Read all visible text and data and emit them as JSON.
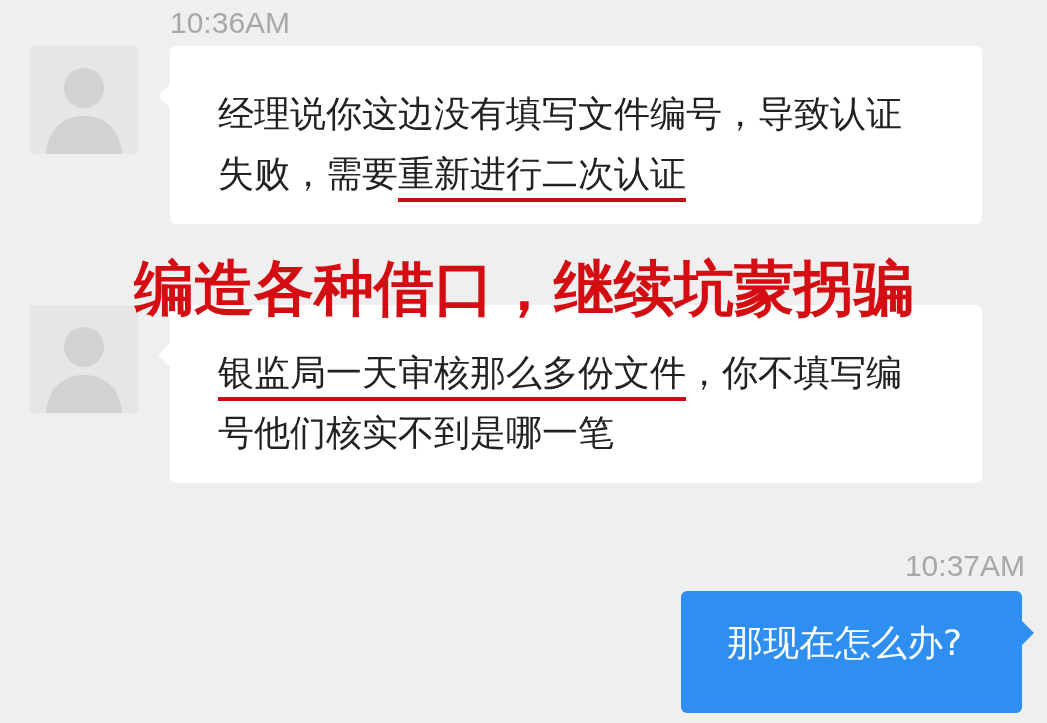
{
  "messages": [
    {
      "time": "10:36AM",
      "kind": "incoming",
      "parts": [
        {
          "text": "经理说你这边没有填写文件编号，导致认证失败，需要",
          "underlined": false
        },
        {
          "text": "重新进行二次认证",
          "underlined": true
        }
      ]
    },
    {
      "kind": "incoming",
      "parts": [
        {
          "text": "银监局一天审核那么多份文件",
          "underlined": true
        },
        {
          "text": "，你不填写编号他们核实不到是哪一笔",
          "underlined": false
        }
      ]
    },
    {
      "time": "10:37AM",
      "kind": "outgoing",
      "parts": [
        {
          "text": "那现在怎么办?",
          "underlined": false
        }
      ]
    }
  ],
  "overlay": {
    "text": "编造各种借口，继续坑蒙拐骗"
  }
}
